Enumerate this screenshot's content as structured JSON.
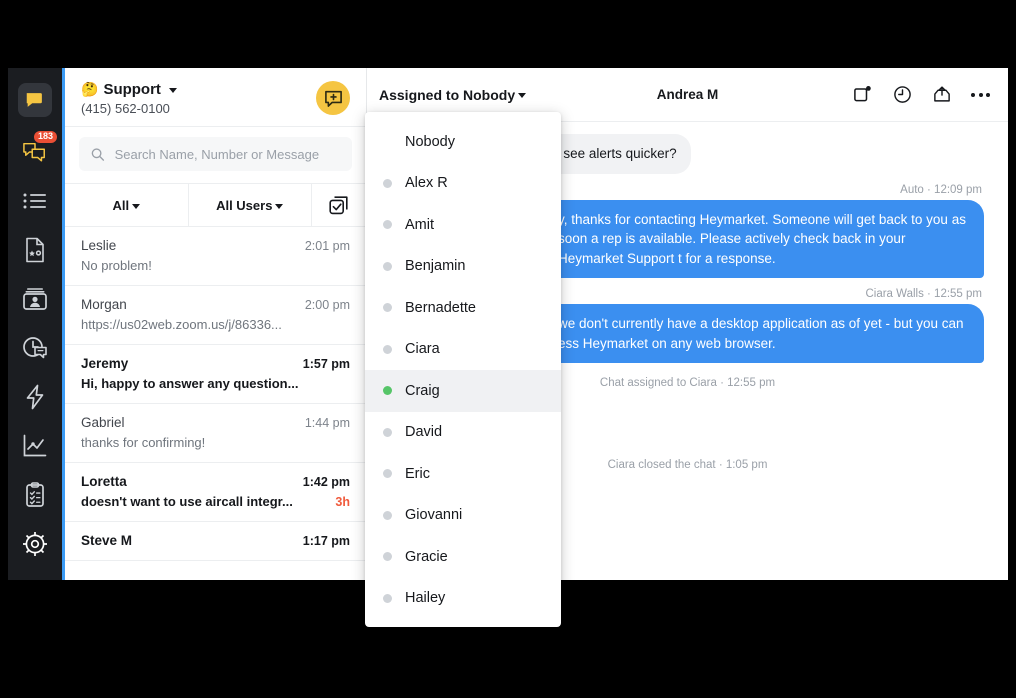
{
  "app": {
    "rail": {
      "items": [
        {
          "name": "heymarket-logo",
          "icon": "chat-bubble-logo-icon",
          "badge": null
        },
        {
          "name": "conversations",
          "icon": "chat-bubbles-icon",
          "badge": "183"
        },
        {
          "name": "lists",
          "icon": "list-icon",
          "badge": null
        },
        {
          "name": "templates",
          "icon": "document-star-icon",
          "badge": null
        },
        {
          "name": "contacts",
          "icon": "contact-card-icon",
          "badge": null
        },
        {
          "name": "scheduled",
          "icon": "clock-bubble-icon",
          "badge": null
        },
        {
          "name": "automations",
          "icon": "lightning-bolt-icon",
          "badge": null
        },
        {
          "name": "reports",
          "icon": "chart-line-icon",
          "badge": null
        },
        {
          "name": "campaigns",
          "icon": "clipboard-checklist-icon",
          "badge": null
        },
        {
          "name": "settings",
          "icon": "gear-icon",
          "badge": null
        }
      ]
    },
    "inbox": {
      "emoji": "🤔",
      "title": "Support",
      "phone": "(415) 562-0100",
      "compose_icon": "compose-message-icon"
    },
    "search": {
      "placeholder": "Search Name, Number or Message",
      "value": "",
      "icon": "search-icon"
    },
    "filters": {
      "status_label": "All",
      "users_label": "All Users",
      "multiselect_icon": "multi-select-checkbox-icon"
    },
    "conversations": [
      {
        "name": "Leslie",
        "time": "2:01 pm",
        "preview": "No problem!",
        "age": "",
        "unread": false
      },
      {
        "name": "Morgan",
        "time": "2:00 pm",
        "preview": "https://us02web.zoom.us/j/86336...",
        "age": "",
        "unread": false
      },
      {
        "name": "Jeremy",
        "time": "1:57 pm",
        "preview": "Hi, happy to answer any question...",
        "age": "",
        "unread": true
      },
      {
        "name": "Gabriel",
        "time": "1:44 pm",
        "preview": "thanks for confirming!",
        "age": "",
        "unread": false
      },
      {
        "name": "Loretta",
        "time": "1:42 pm",
        "preview": "doesn't want to use aircall integr...",
        "age": "3h",
        "unread": true
      },
      {
        "name": "Steve M",
        "time": "1:17 pm",
        "preview": "",
        "age": "",
        "unread": true
      }
    ],
    "chat": {
      "assigned_label": "Assigned to Nobody",
      "contact_name": "Andrea M",
      "actions": [
        {
          "name": "mark-unread-icon",
          "label": ""
        },
        {
          "name": "clock-history-icon",
          "label": ""
        },
        {
          "name": "archive-upload-icon",
          "label": ""
        },
        {
          "name": "more-options-icon",
          "label": ""
        }
      ],
      "messages": [
        {
          "kind": "bubble",
          "direction": "in",
          "text": "a app. on my desktop so I see alerts quicker?",
          "meta": ""
        },
        {
          "kind": "bubble",
          "direction": "out",
          "text": "y, thanks for contacting Heymarket. Someone will get back to you as soon a rep is available. Please actively check back in your Heymarket Support t for a response.",
          "meta": "Auto · 12:09 pm"
        },
        {
          "kind": "bubble",
          "direction": "out",
          "text": "we don't currently have a desktop application as of yet - but you can ess Heymarket on any web browser.",
          "meta": "Ciara Walls · 12:55 pm"
        },
        {
          "kind": "event",
          "text": "Chat assigned to Ciara · 12:55 pm"
        },
        {
          "kind": "event",
          "text": "Ciara closed the chat · 1:05 pm"
        }
      ]
    },
    "assign_menu": {
      "items": [
        {
          "label": "Nobody",
          "presence": "none",
          "active": false
        },
        {
          "label": "Alex R",
          "presence": "offline",
          "active": false
        },
        {
          "label": "Amit",
          "presence": "offline",
          "active": false
        },
        {
          "label": "Benjamin",
          "presence": "offline",
          "active": false
        },
        {
          "label": "Bernadette",
          "presence": "offline",
          "active": false
        },
        {
          "label": "Ciara",
          "presence": "offline",
          "active": false
        },
        {
          "label": "Craig",
          "presence": "online",
          "active": true
        },
        {
          "label": "David",
          "presence": "offline",
          "active": false
        },
        {
          "label": "Eric",
          "presence": "offline",
          "active": false
        },
        {
          "label": "Giovanni",
          "presence": "offline",
          "active": false
        },
        {
          "label": "Gracie",
          "presence": "offline",
          "active": false
        },
        {
          "label": "Hailey",
          "presence": "offline",
          "active": false
        }
      ]
    },
    "colors": {
      "accent_blue": "#3b8ff0",
      "brand_yellow": "#f5c542",
      "rail_dark": "#1b1d21",
      "badge_red": "#ea4f35",
      "online_green": "#56c568",
      "overdue_orange": "#f05a3c"
    }
  }
}
